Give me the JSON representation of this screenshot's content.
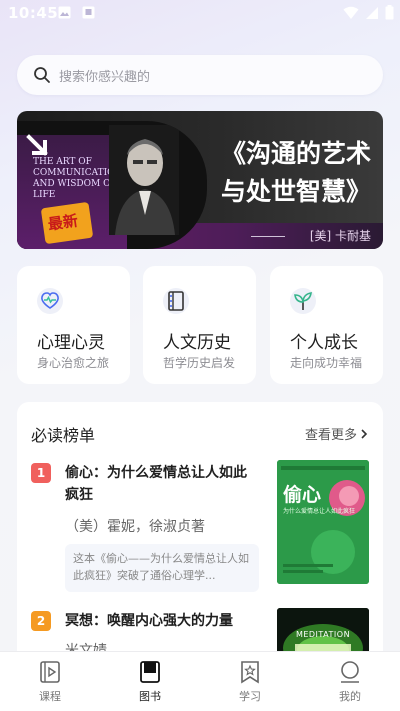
{
  "status_bar": {
    "time": "10:45"
  },
  "search": {
    "placeholder": "搜索你感兴趣的"
  },
  "banner": {
    "title_line1": "《沟通的艺术",
    "title_line2": "与处世智慧》",
    "author": "[美] 卡耐基",
    "cover_title": "THE ART OF COMMUNICATION AND WISDOM OF LIFE",
    "cover_badge": "最新",
    "cover_side": "COMMUNICATION"
  },
  "categories": [
    {
      "title": "心理心灵",
      "subtitle": "身心治愈之旅",
      "icon": "heart-pulse-icon"
    },
    {
      "title": "人文历史",
      "subtitle": "哲学历史启发",
      "icon": "film-book-icon"
    },
    {
      "title": "个人成长",
      "subtitle": "走向成功幸福",
      "icon": "sprout-icon"
    }
  ],
  "ranking": {
    "heading": "必读榜单",
    "more_label": "查看更多",
    "items": [
      {
        "rank": "1",
        "title": "偷心：为什么爱情总让人如此疯狂",
        "author": "（美）霍妮，徐淑贞著",
        "desc": "这本《偷心——为什么爱情总让人如此疯狂》突破了通俗心理学...",
        "cover_title": "偷心",
        "cover_sub": "为什么爱情总让人如此疯狂",
        "badge_color": "#f0605d"
      },
      {
        "rank": "2",
        "title": "冥想：唤醒内心强大的力量",
        "author": "米文婧",
        "cover_title": "MEDITATION",
        "badge_color": "#f59a22"
      }
    ]
  },
  "bottom_nav": {
    "items": [
      {
        "label": "课程",
        "icon": "play-course-icon"
      },
      {
        "label": "图书",
        "icon": "book-icon"
      },
      {
        "label": "学习",
        "icon": "bookmark-star-icon"
      },
      {
        "label": "我的",
        "icon": "profile-icon"
      }
    ],
    "active_index": 1
  },
  "colors": {
    "accent_rank1": "#f0605d",
    "accent_rank2": "#f59a22",
    "banner_strip": "#5c1f6a"
  }
}
